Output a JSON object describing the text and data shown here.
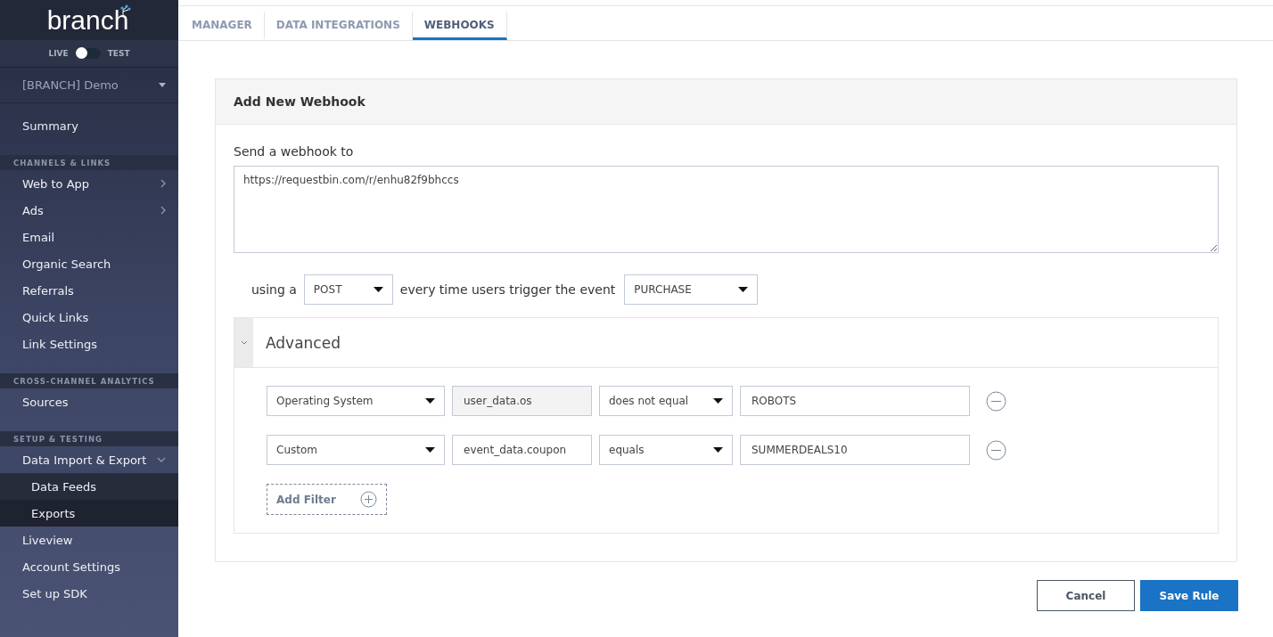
{
  "sidebar": {
    "logo": "branch",
    "env_toggle": {
      "left_label": "LIVE",
      "right_label": "TEST",
      "test": false
    },
    "app_selector": "[BRANCH] Demo",
    "top_items": [
      {
        "label": "Summary"
      }
    ],
    "sections": [
      {
        "title": "CHANNELS & LINKS",
        "items": [
          {
            "label": "Web to App",
            "kind": "submenu"
          },
          {
            "label": "Ads",
            "kind": "submenu"
          },
          {
            "label": "Email",
            "kind": "plain"
          },
          {
            "label": "Organic Search",
            "kind": "plain"
          },
          {
            "label": "Referrals",
            "kind": "plain"
          },
          {
            "label": "Quick Links",
            "kind": "plain"
          },
          {
            "label": "Link Settings",
            "kind": "plain"
          }
        ]
      },
      {
        "title": "CROSS-CHANNEL ANALYTICS",
        "items": [
          {
            "label": "Sources",
            "kind": "plain"
          }
        ]
      },
      {
        "title": "SETUP & TESTING",
        "items": [
          {
            "label": "Data Import & Export",
            "kind": "group",
            "expanded": true,
            "children": [
              {
                "label": "Data Feeds"
              },
              {
                "label": "Exports"
              }
            ]
          },
          {
            "label": "Liveview",
            "kind": "plain"
          },
          {
            "label": "Account Settings",
            "kind": "plain"
          },
          {
            "label": "Set up SDK",
            "kind": "plain"
          }
        ]
      }
    ]
  },
  "tabs": [
    {
      "label": "MANAGER",
      "selected": false
    },
    {
      "label": "DATA INTEGRATIONS",
      "selected": false
    },
    {
      "label": "WEBHOOKS",
      "selected": true
    }
  ],
  "card": {
    "title": "Add New Webhook",
    "url_label": "Send a webhook to",
    "url_value": "https://requestbin.com/r/enhu82f9bhccs",
    "using_label": "using a",
    "method": "POST",
    "event_label": "every time users trigger the event",
    "event": "PURCHASE",
    "advanced": {
      "title": "Advanced",
      "expanded": true,
      "filters": [
        {
          "property": "Operating System",
          "key": "user_data.os",
          "key_disabled": true,
          "operator": "does not equal",
          "value": "ROBOTS"
        },
        {
          "property": "Custom",
          "key": "event_data.coupon",
          "key_disabled": false,
          "operator": "equals",
          "value": "SUMMERDEALS10"
        }
      ],
      "add_filter": "Add Filter"
    }
  },
  "buttons": {
    "cancel": "Cancel",
    "save": "Save Rule"
  }
}
